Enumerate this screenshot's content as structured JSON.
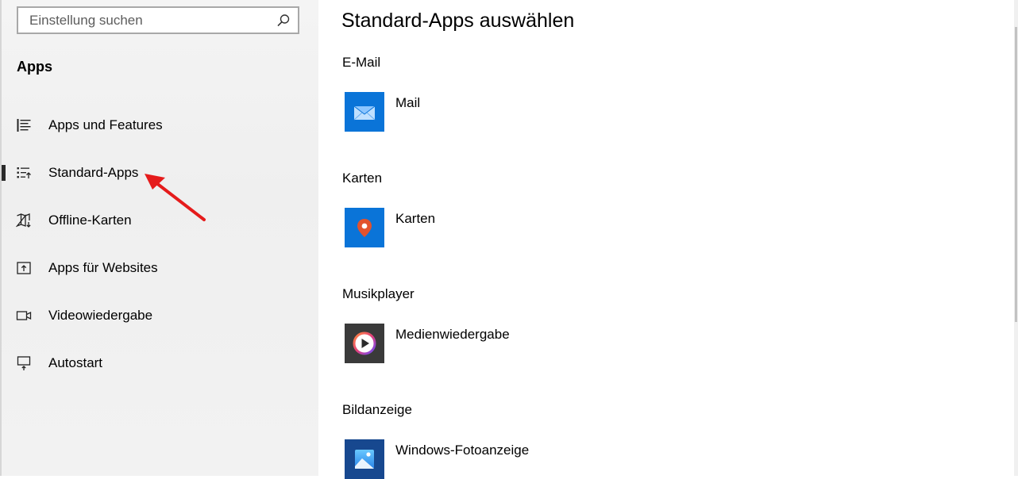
{
  "sidebar": {
    "search": {
      "placeholder": "Einstellung suchen",
      "icon": "search-icon"
    },
    "section_title": "Apps",
    "items": [
      {
        "label": "Apps und Features",
        "icon": "apps-features-icon",
        "selected": false
      },
      {
        "label": "Standard-Apps",
        "icon": "default-apps-icon",
        "selected": true
      },
      {
        "label": "Offline-Karten",
        "icon": "offline-maps-icon",
        "selected": false
      },
      {
        "label": "Apps für Websites",
        "icon": "apps-websites-icon",
        "selected": false
      },
      {
        "label": "Videowiedergabe",
        "icon": "video-playback-icon",
        "selected": false
      },
      {
        "label": "Autostart",
        "icon": "startup-icon",
        "selected": false
      }
    ]
  },
  "main": {
    "title": "Standard-Apps auswählen",
    "categories": [
      {
        "label": "E-Mail",
        "app": "Mail",
        "icon": "mail-icon",
        "color": "#0a74d8"
      },
      {
        "label": "Karten",
        "app": "Karten",
        "icon": "maps-pin-icon",
        "color": "#0a74d8"
      },
      {
        "label": "Musikplayer",
        "app": "Medienwiedergabe",
        "icon": "media-player-icon",
        "color": "#3a3a3a"
      },
      {
        "label": "Bildanzeige",
        "app": "Windows-Fotoanzeige",
        "icon": "photo-viewer-icon",
        "color": "#17488f"
      }
    ]
  },
  "colors": {
    "accent": "#0078d7",
    "annotation_arrow": "#e51b1b",
    "sidebar_bg": "#f2f2f2"
  }
}
